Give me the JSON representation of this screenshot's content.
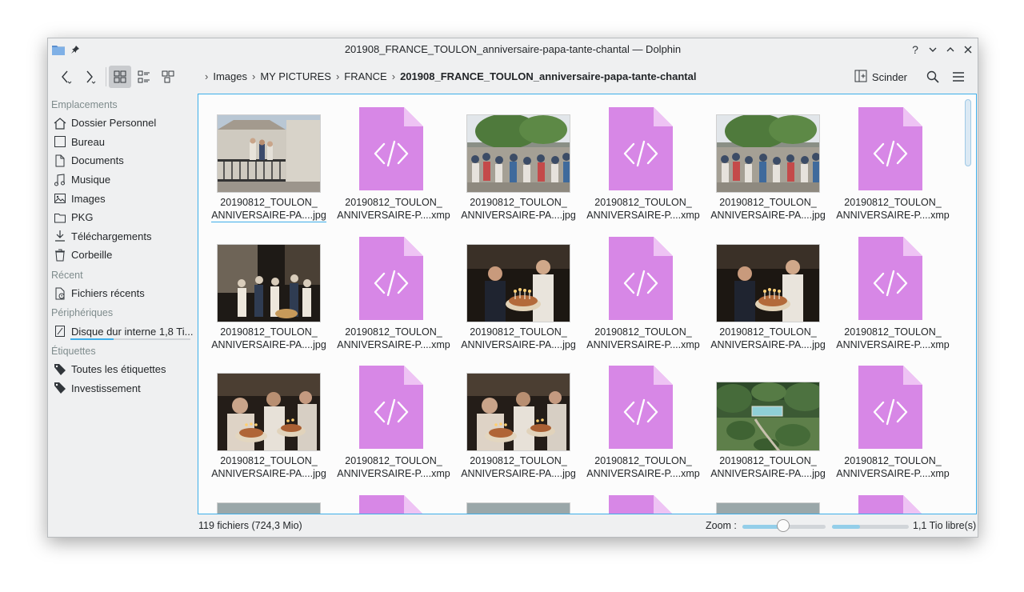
{
  "window": {
    "title": "201908_FRANCE_TOULON_anniversaire-papa-tante-chantal — Dolphin"
  },
  "toolbar": {
    "breadcrumb": [
      "Images",
      "MY PICTURES",
      "FRANCE",
      "201908_FRANCE_TOULON_anniversaire-papa-tante-chantal"
    ],
    "split_label": "Scinder"
  },
  "sidebar": {
    "sections": [
      {
        "title": "Emplacements",
        "items": [
          {
            "label": "Dossier Personnel",
            "icon": "home-icon"
          },
          {
            "label": "Bureau",
            "icon": "desktop-icon"
          },
          {
            "label": "Documents",
            "icon": "documents-icon"
          },
          {
            "label": "Musique",
            "icon": "music-icon"
          },
          {
            "label": "Images",
            "icon": "pictures-icon"
          },
          {
            "label": "PKG",
            "icon": "folder-icon"
          },
          {
            "label": "Téléchargements",
            "icon": "download-icon"
          },
          {
            "label": "Corbeille",
            "icon": "trash-icon"
          }
        ]
      },
      {
        "title": "Récent",
        "items": [
          {
            "label": "Fichiers récents",
            "icon": "recent-files-icon"
          }
        ]
      },
      {
        "title": "Périphériques",
        "items": [
          {
            "label": "Disque dur interne 1,8 Ti...",
            "icon": "harddisk-icon"
          }
        ]
      },
      {
        "title": "Étiquettes",
        "items": [
          {
            "label": "Toutes les étiquettes",
            "icon": "tag-icon"
          },
          {
            "label": "Investissement",
            "icon": "tag-icon"
          }
        ]
      }
    ]
  },
  "files": [
    {
      "l1": "20190812_TOULON_",
      "l2": "ANNIVERSAIRE-PA....jpg",
      "kind": "photo",
      "scene": "balcony"
    },
    {
      "l1": "20190812_TOULON_",
      "l2": "ANNIVERSAIRE-P....xmp",
      "kind": "xmp"
    },
    {
      "l1": "20190812_TOULON_",
      "l2": "ANNIVERSAIRE-PA....jpg",
      "kind": "photo",
      "scene": "crowd"
    },
    {
      "l1": "20190812_TOULON_",
      "l2": "ANNIVERSAIRE-P....xmp",
      "kind": "xmp"
    },
    {
      "l1": "20190812_TOULON_",
      "l2": "ANNIVERSAIRE-PA....jpg",
      "kind": "photo",
      "scene": "crowd"
    },
    {
      "l1": "20190812_TOULON_",
      "l2": "ANNIVERSAIRE-P....xmp",
      "kind": "xmp"
    },
    {
      "l1": "20190812_TOULON_",
      "l2": "ANNIVERSAIRE-PA....jpg",
      "kind": "photo",
      "scene": "night"
    },
    {
      "l1": "20190812_TOULON_",
      "l2": "ANNIVERSAIRE-P....xmp",
      "kind": "xmp"
    },
    {
      "l1": "20190812_TOULON_",
      "l2": "ANNIVERSAIRE-PA....jpg",
      "kind": "photo",
      "scene": "cake"
    },
    {
      "l1": "20190812_TOULON_",
      "l2": "ANNIVERSAIRE-P....xmp",
      "kind": "xmp"
    },
    {
      "l1": "20190812_TOULON_",
      "l2": "ANNIVERSAIRE-PA....jpg",
      "kind": "photo",
      "scene": "cake"
    },
    {
      "l1": "20190812_TOULON_",
      "l2": "ANNIVERSAIRE-P....xmp",
      "kind": "xmp"
    },
    {
      "l1": "20190812_TOULON_",
      "l2": "ANNIVERSAIRE-PA....jpg",
      "kind": "photo",
      "scene": "cake2"
    },
    {
      "l1": "20190812_TOULON_",
      "l2": "ANNIVERSAIRE-P....xmp",
      "kind": "xmp"
    },
    {
      "l1": "20190812_TOULON_",
      "l2": "ANNIVERSAIRE-PA....jpg",
      "kind": "photo",
      "scene": "cake2"
    },
    {
      "l1": "20190812_TOULON_",
      "l2": "ANNIVERSAIRE-P....xmp",
      "kind": "xmp"
    },
    {
      "l1": "20190812_TOULON_",
      "l2": "ANNIVERSAIRE-PA....jpg",
      "kind": "photo",
      "scene": "garden"
    },
    {
      "l1": "20190812_TOULON_",
      "l2": "ANNIVERSAIRE-P....xmp",
      "kind": "xmp"
    },
    {
      "l1": "",
      "l2": "",
      "kind": "photo",
      "scene": "partial"
    },
    {
      "l1": "",
      "l2": "",
      "kind": "xmp"
    },
    {
      "l1": "",
      "l2": "",
      "kind": "photo",
      "scene": "partial"
    },
    {
      "l1": "",
      "l2": "",
      "kind": "xmp"
    },
    {
      "l1": "",
      "l2": "",
      "kind": "photo",
      "scene": "partial"
    },
    {
      "l1": "",
      "l2": "",
      "kind": "xmp"
    }
  ],
  "status": {
    "summary": "119 fichiers (724,3 Mio)",
    "zoom_label": "Zoom :",
    "zoom_level": 0.5,
    "free_space": "1,1 Tio libre(s)",
    "disk_used_fraction": 0.36
  },
  "colors": {
    "accent": "#3daee9",
    "xmp_icon": "#d787e6",
    "xmp_fold": "#eec3f4"
  }
}
